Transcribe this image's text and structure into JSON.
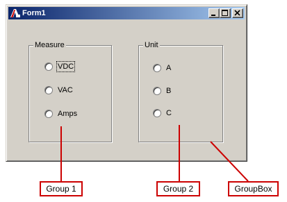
{
  "window": {
    "title": "Form1"
  },
  "group1": {
    "legend": "Measure",
    "options": [
      {
        "label": "VDC",
        "focused": true
      },
      {
        "label": "VAC",
        "focused": false
      },
      {
        "label": "Amps",
        "focused": false
      }
    ]
  },
  "group2": {
    "legend": "Unit",
    "options": [
      {
        "label": "A"
      },
      {
        "label": "B"
      },
      {
        "label": "C"
      }
    ]
  },
  "annotations": {
    "group1": "Group 1",
    "group2": "Group 2",
    "groupbox": "GroupBox",
    "color": "#cc0000"
  }
}
